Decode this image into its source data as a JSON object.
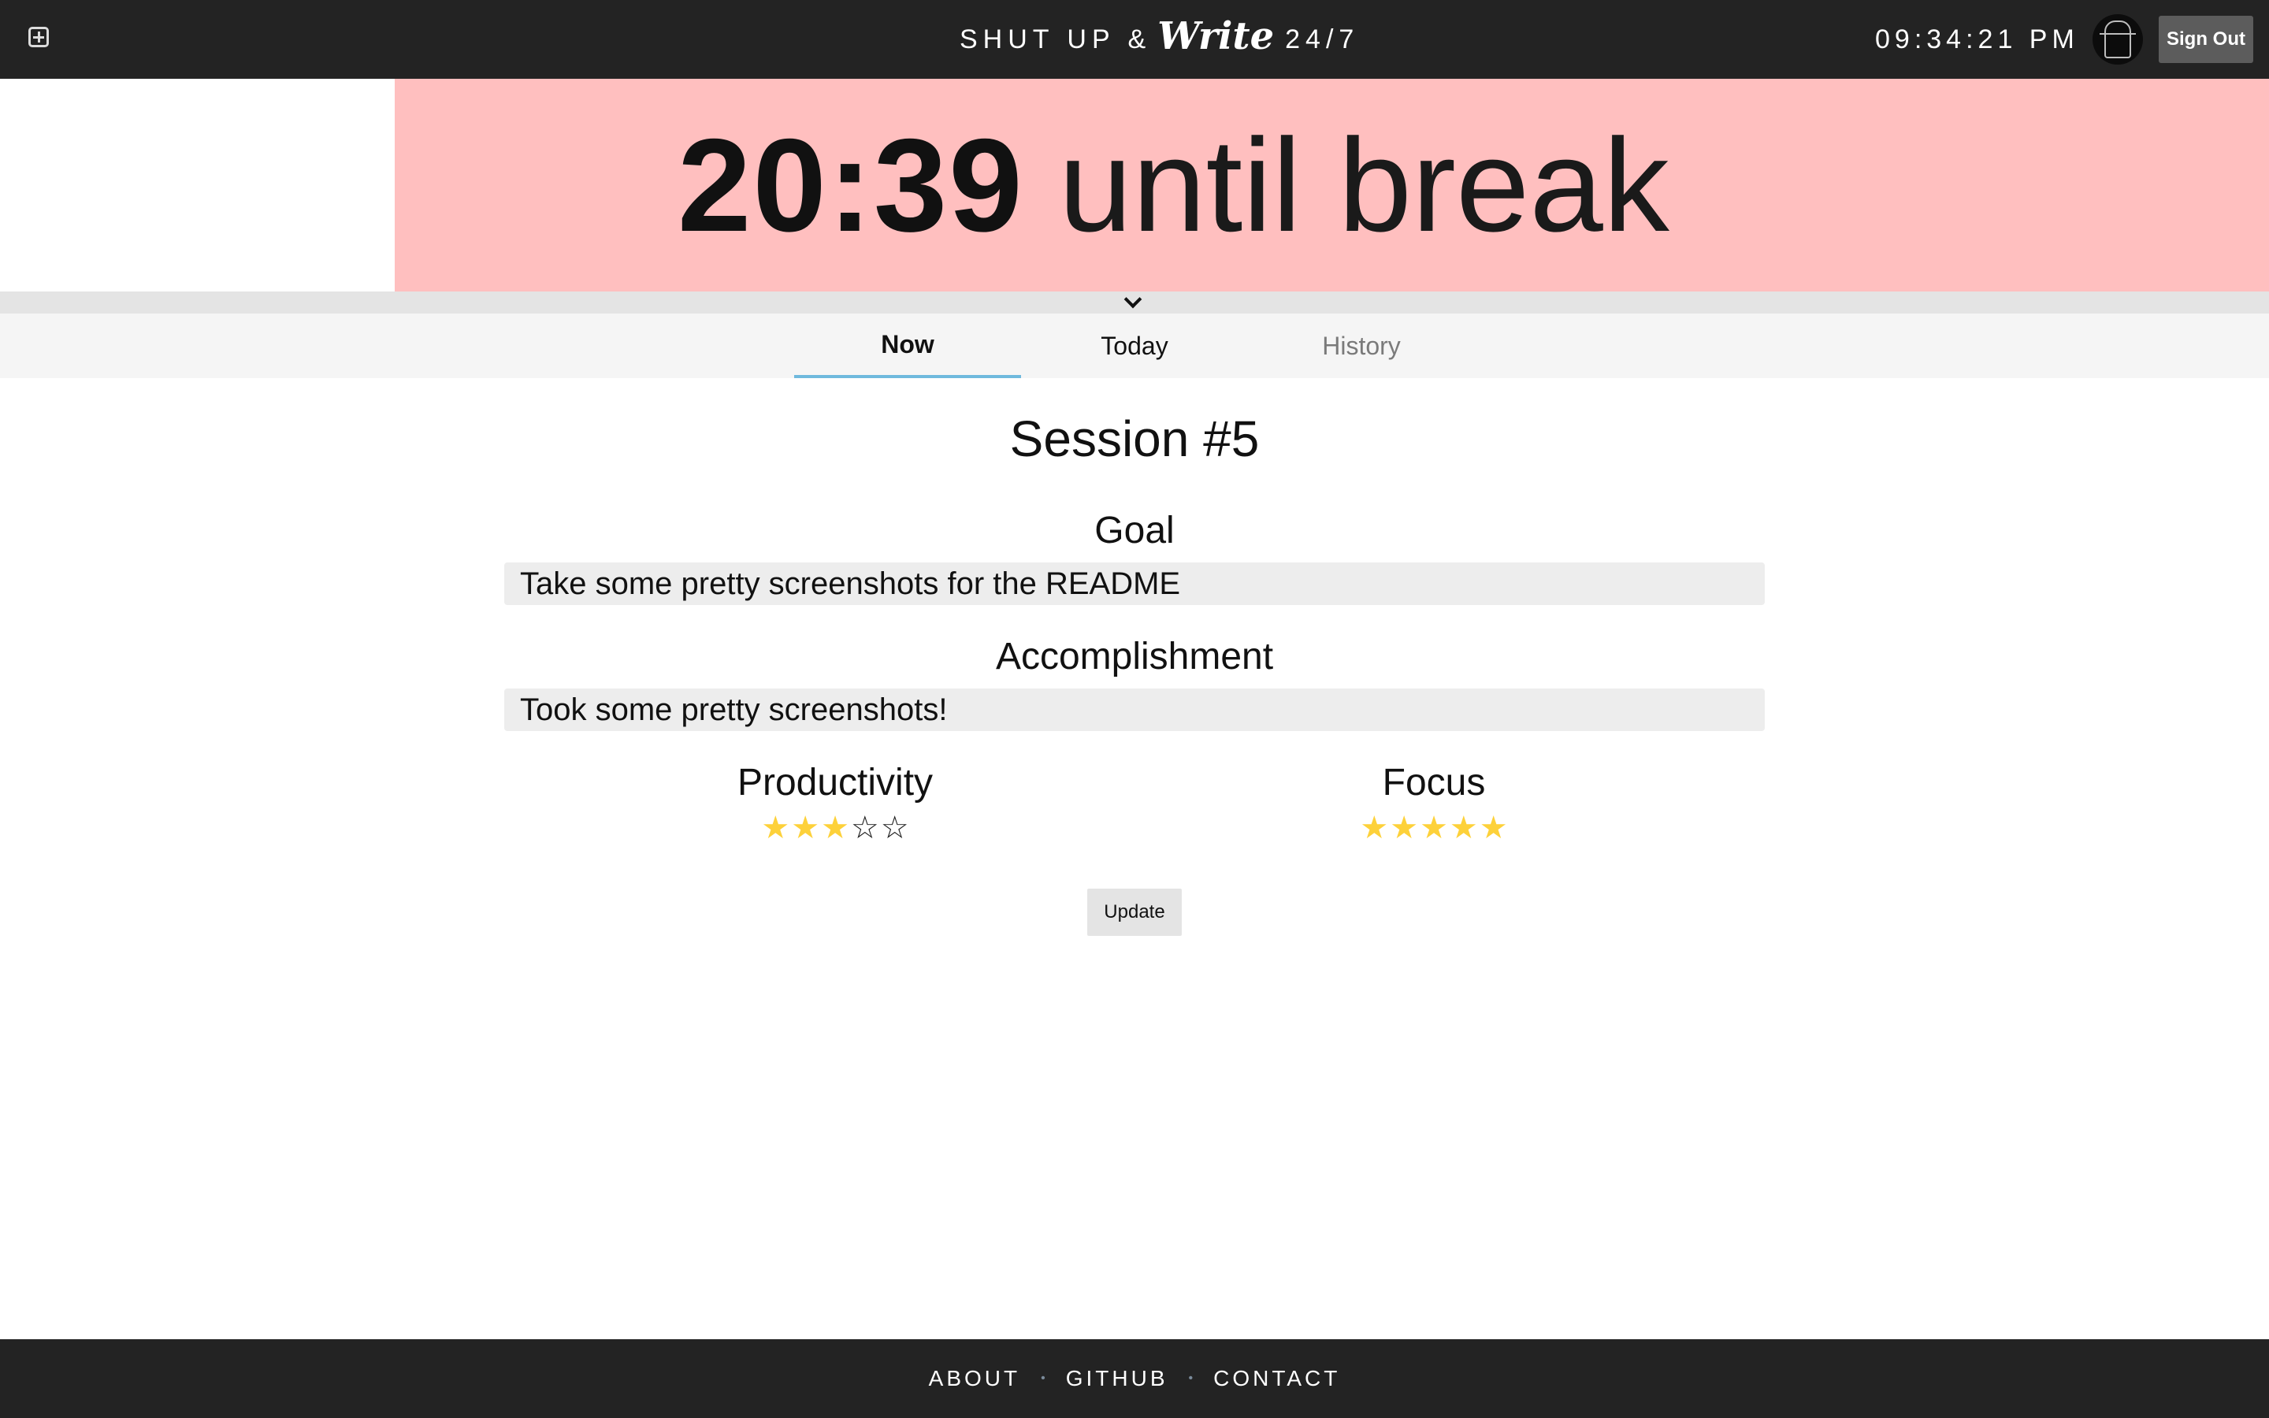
{
  "header": {
    "brand_left": "SHUT UP &",
    "brand_script": "Write",
    "brand_right": "24/7",
    "clock": "09:34:21 PM",
    "sign_out_label": "Sign Out"
  },
  "timer": {
    "time": "20:39",
    "label": "until break",
    "progress_fraction": 0.826,
    "progress_color": "#ffbfbf"
  },
  "tabs": [
    {
      "label": "Now",
      "active": true
    },
    {
      "label": "Today",
      "active": false
    },
    {
      "label": "History",
      "active": false
    }
  ],
  "session": {
    "title": "Session #5",
    "goal_heading": "Goal",
    "goal_value": "Take some pretty screenshots for the README",
    "accomplishment_heading": "Accomplishment",
    "accomplishment_value": "Took some pretty screenshots!",
    "productivity": {
      "label": "Productivity",
      "rating": 3,
      "max": 5
    },
    "focus": {
      "label": "Focus",
      "rating": 5,
      "max": 5
    },
    "update_label": "Update"
  },
  "footer": {
    "links": [
      "ABOUT",
      "GITHUB",
      "CONTACT"
    ],
    "separator": "•"
  },
  "colors": {
    "topbar": "#232323",
    "timer_fill": "#ffbfbf",
    "tab_underline": "#6fb9dd",
    "star_on": "#fdd13a"
  },
  "icons": {
    "add": "add-square-icon",
    "collapse": "chevron-down-icon",
    "star": "star-icon"
  }
}
